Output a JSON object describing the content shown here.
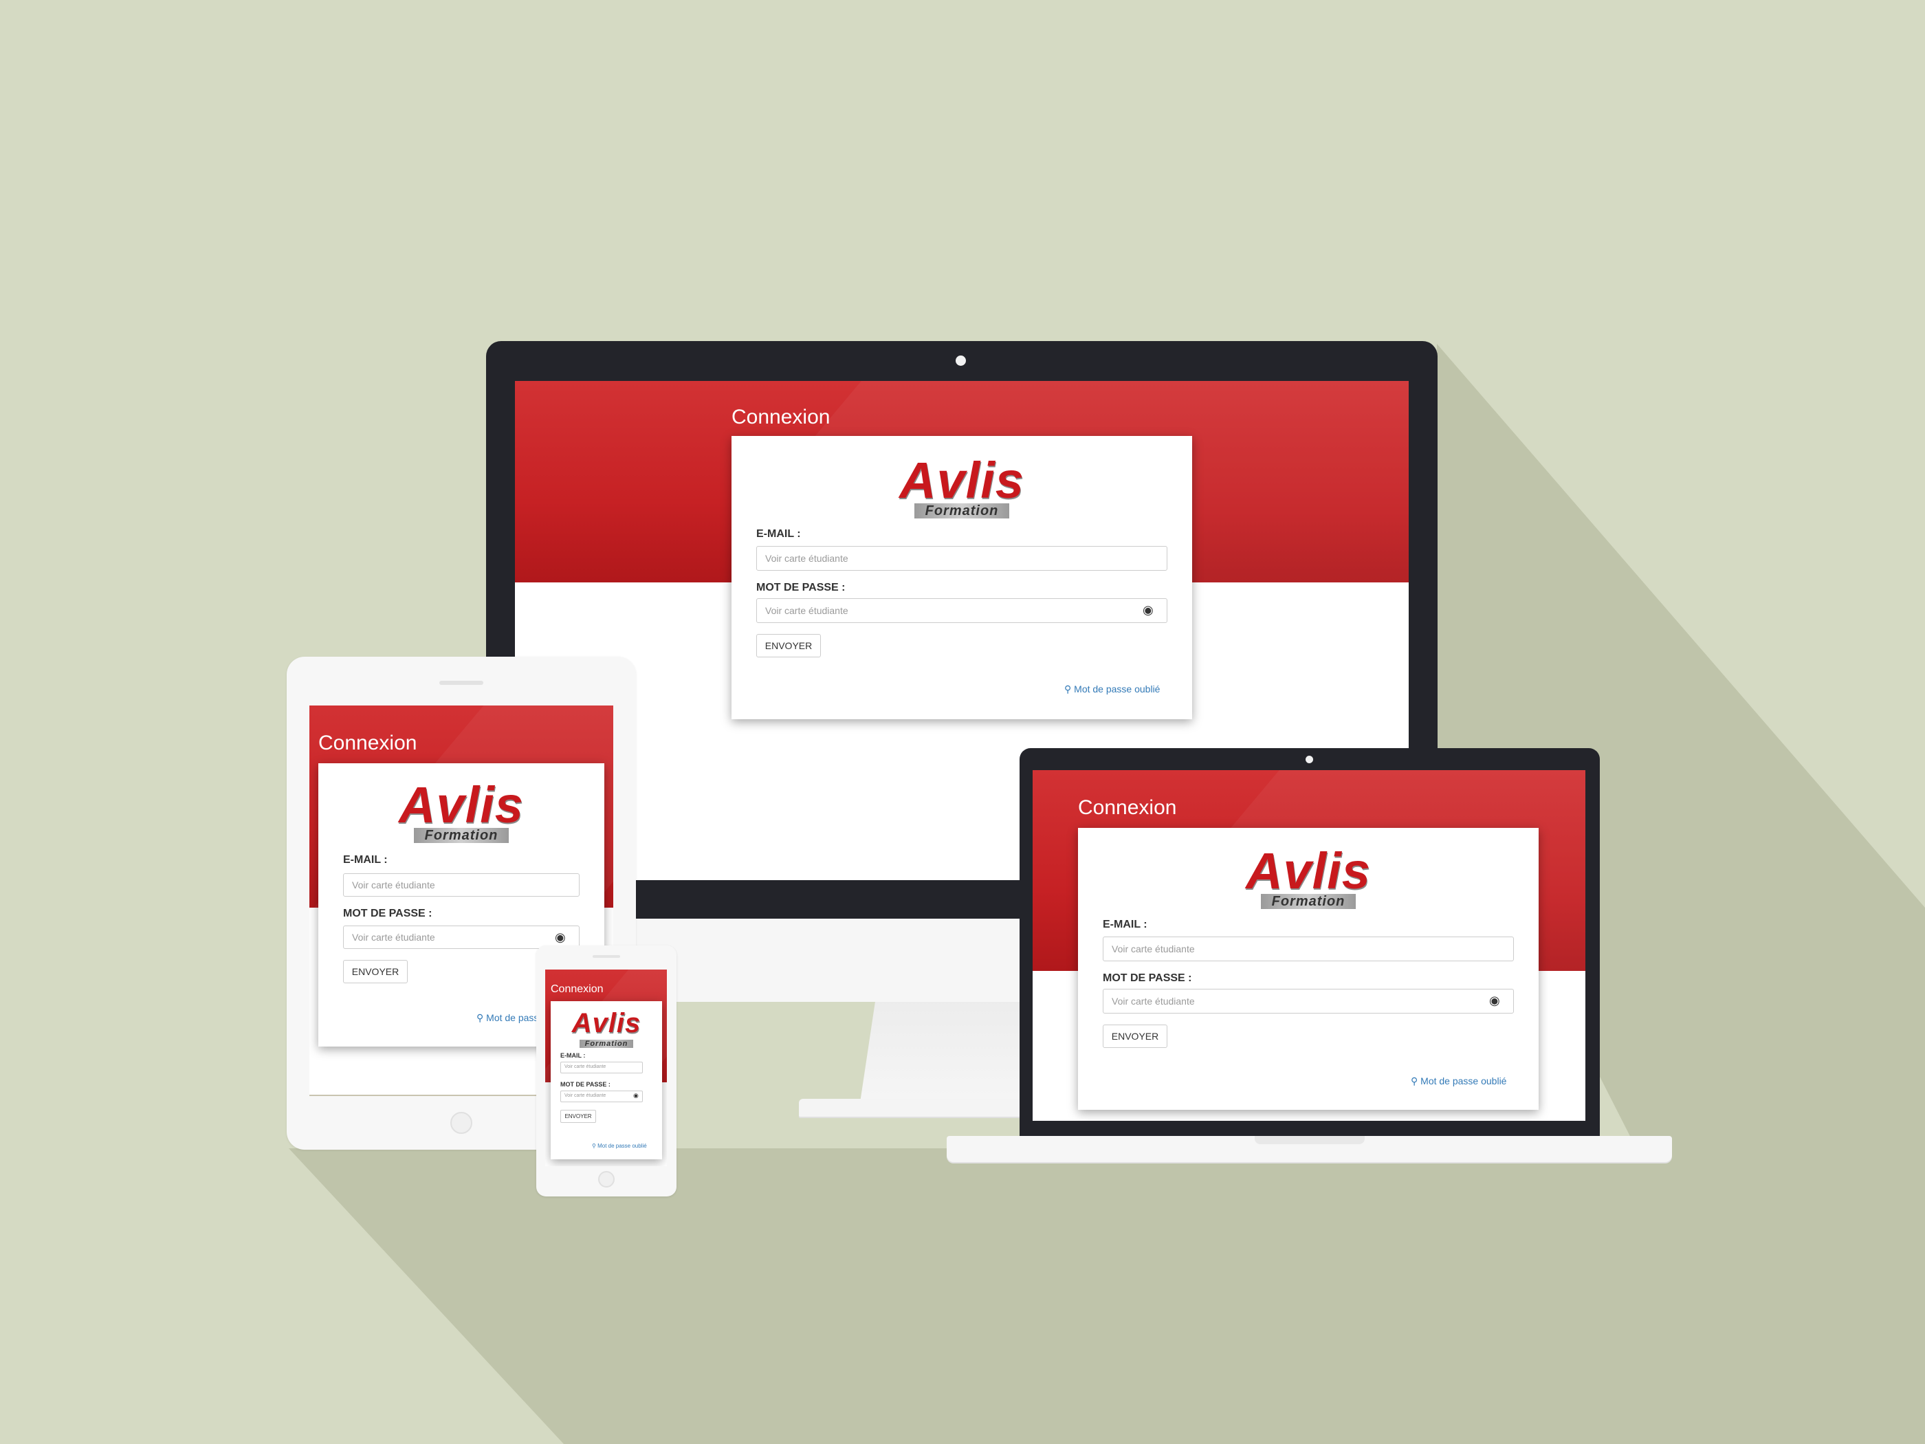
{
  "page": {
    "title": "Connexion"
  },
  "brand": {
    "name": "Avlis",
    "tagline": "Formation"
  },
  "form": {
    "email_label": "E-MAIL :",
    "email_placeholder": "Voir carte étudiante",
    "password_label": "MOT DE PASSE :",
    "password_placeholder": "Voir carte étudiante",
    "submit_label": "ENVOYER",
    "forgot_label": "Mot de passe oublié",
    "forgot_label_truncated": "Mot de pass"
  },
  "icons": {
    "eye": "eye-icon",
    "search": "search-icon"
  },
  "colors": {
    "background": "#d5dac3",
    "shadow": "#bfc4aa",
    "brand_red": "#c8191d",
    "link": "#337ab7",
    "bezel": "#23242a"
  }
}
